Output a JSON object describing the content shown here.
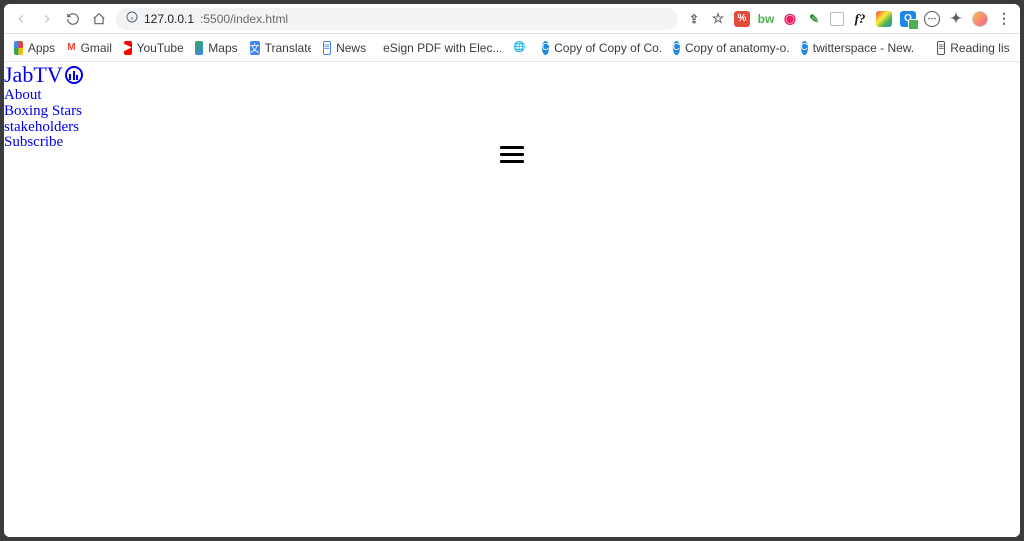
{
  "browser": {
    "url_host": "127.0.0.1",
    "url_port_path": ":5500/index.html"
  },
  "extensions": {
    "f_label": "f?"
  },
  "bookmarks": {
    "items": [
      {
        "label": "Apps",
        "favicon": "grid"
      },
      {
        "label": "Gmail",
        "favicon": "gmail"
      },
      {
        "label": "YouTube",
        "favicon": "youtube"
      },
      {
        "label": "Maps",
        "favicon": "maps"
      },
      {
        "label": "Translate",
        "favicon": "translate"
      },
      {
        "label": "News",
        "favicon": "news"
      },
      {
        "label": "eSign PDF with Elec...",
        "favicon": "esign"
      },
      {
        "label": "",
        "favicon": "globe"
      },
      {
        "label": "Copy of Copy of Co...",
        "favicon": "c-blue"
      },
      {
        "label": "Copy of anatomy-o...",
        "favicon": "c-blue"
      },
      {
        "label": "twitterspace - New...",
        "favicon": "c-blue"
      }
    ],
    "reading_list": "Reading list"
  },
  "page": {
    "brand": "JabTV",
    "nav": [
      "About",
      "Boxing Stars",
      "stakeholders",
      "Subscribe"
    ]
  }
}
